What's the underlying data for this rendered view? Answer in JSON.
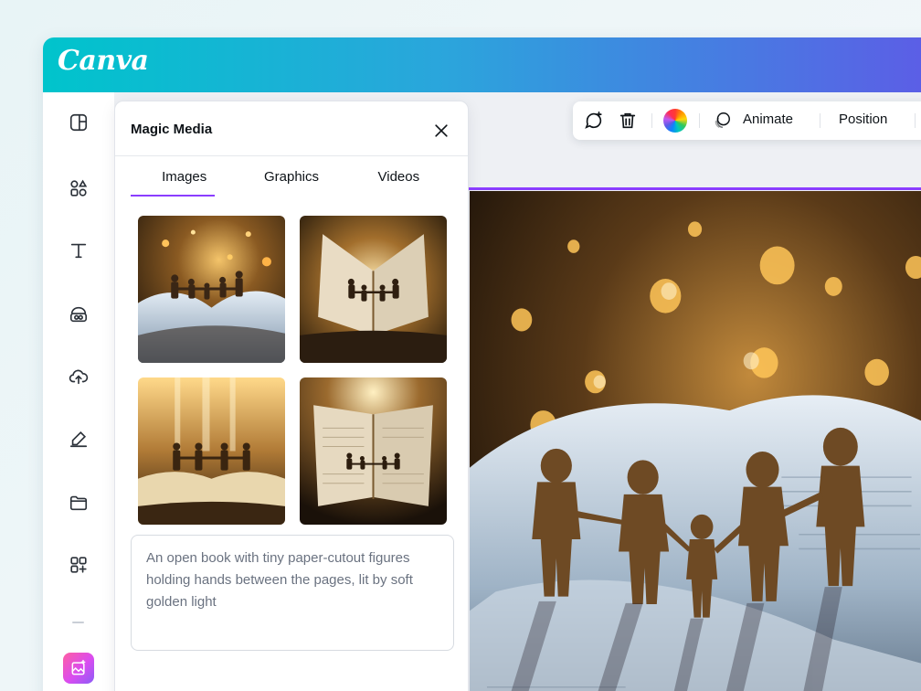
{
  "app": {
    "logo_text": "Canva",
    "brand_gradient": [
      "#00c4cc",
      "#5d5ce6"
    ]
  },
  "rail": {
    "items": [
      {
        "icon": "layout-icon"
      },
      {
        "icon": "elements-icon"
      },
      {
        "icon": "text-icon"
      },
      {
        "icon": "brand-icon"
      },
      {
        "icon": "upload-icon"
      },
      {
        "icon": "draw-icon"
      },
      {
        "icon": "projects-icon"
      },
      {
        "icon": "apps-icon"
      }
    ],
    "active_app_icon": "magic-media-icon"
  },
  "panel": {
    "title": "Magic Media",
    "tabs": [
      {
        "label": "Images",
        "active": true
      },
      {
        "label": "Graphics",
        "active": false
      },
      {
        "label": "Videos",
        "active": false
      }
    ],
    "results_count": 4,
    "prompt_text": "An open book with tiny paper-cutout figures holding hands between the pages, lit by soft golden light"
  },
  "toolbar": {
    "animate_label": "Animate",
    "position_label": "Position"
  },
  "colors": {
    "accent": "#8b3dff",
    "text": "#0e1318",
    "muted": "#6a7280"
  }
}
